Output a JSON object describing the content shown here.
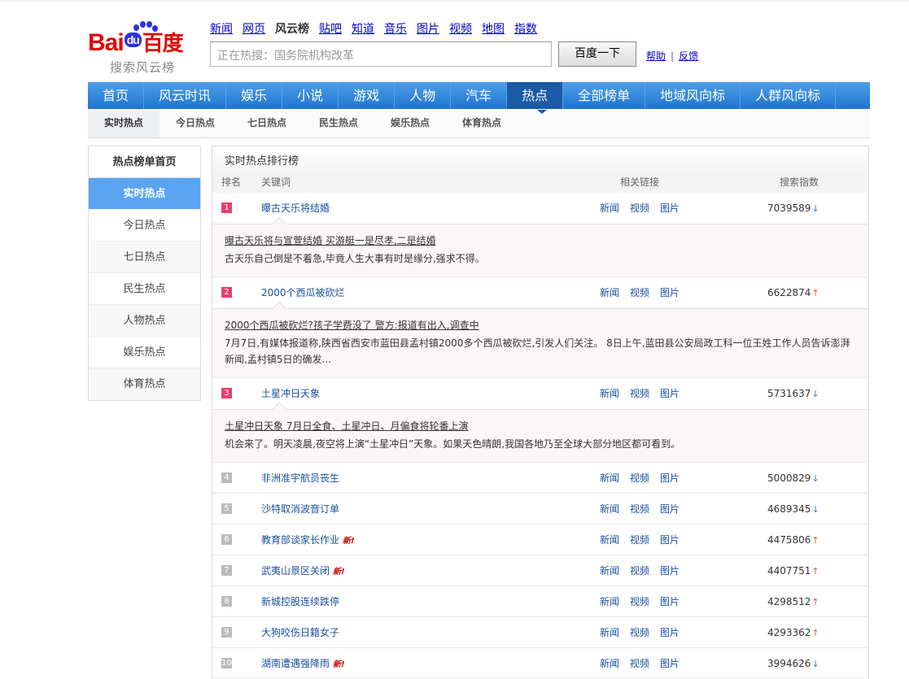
{
  "logo": {
    "text_bai": "Bai",
    "text_du": "du",
    "text_cn": "百度",
    "subtitle": "搜索风云榜"
  },
  "topnav": [
    {
      "label": "新闻",
      "current": false
    },
    {
      "label": "网页",
      "current": false
    },
    {
      "label": "风云榜",
      "current": true
    },
    {
      "label": "贴吧",
      "current": false
    },
    {
      "label": "知道",
      "current": false
    },
    {
      "label": "音乐",
      "current": false
    },
    {
      "label": "图片",
      "current": false
    },
    {
      "label": "视频",
      "current": false
    },
    {
      "label": "地图",
      "current": false
    },
    {
      "label": "指数",
      "current": false
    }
  ],
  "search": {
    "placeholder": "正在热搜：国务院机构改革",
    "button": "百度一下"
  },
  "help": {
    "help": "帮助",
    "sep": "|",
    "feedback": "反馈"
  },
  "mainnav": [
    "首页",
    "风云时讯",
    "娱乐",
    "小说",
    "游戏",
    "人物",
    "汽车",
    "热点",
    "全部榜单",
    "地域风向标",
    "人群风向标"
  ],
  "mainnav_active": "热点",
  "subnav": [
    "实时热点",
    "今日热点",
    "七日热点",
    "民生热点",
    "娱乐热点",
    "体育热点"
  ],
  "subnav_active": "实时热点",
  "sidebar": {
    "title": "热点榜单首页",
    "items": [
      "实时热点",
      "今日热点",
      "七日热点",
      "民生热点",
      "人物热点",
      "娱乐热点",
      "体育热点"
    ],
    "active": "实时热点"
  },
  "panel": {
    "title": "实时热点排行榜",
    "columns": {
      "rank": "排名",
      "keyword": "关键词",
      "links": "相关链接",
      "index": "搜索指数"
    },
    "link_labels": [
      "新闻",
      "视频",
      "图片"
    ],
    "rows": [
      {
        "rank": "1",
        "keyword": "曝古天乐将结婚",
        "index": "7039589",
        "trend": "down",
        "new": false,
        "detail": {
          "headline": "曝古天乐将与宣萱结婚 买游艇一是尽孝,二是结婚",
          "text": "古天乐自己倒是不着急,毕竟人生大事有时是缘分,强求不得。"
        }
      },
      {
        "rank": "2",
        "keyword": "2000个西瓜被砍烂",
        "index": "6622874",
        "trend": "up",
        "new": false,
        "detail": {
          "headline": "2000个西瓜被砍烂?孩子学费没了 警方:报道有出入,调查中",
          "text": "7月7日,有媒体报道称,陕西省西安市蓝田县孟村镇2000多个西瓜被砍烂,引发人们关注。 8日上午,蓝田县公安局政工科一位王姓工作人员告诉澎湃新闻,孟村镇5日的确发..."
        }
      },
      {
        "rank": "3",
        "keyword": "土星冲日天象",
        "index": "5731637",
        "trend": "down",
        "new": false,
        "detail": {
          "headline": "土星冲日天象 7月日全食、土星冲日、月偏食将轮番上演",
          "text": "机会来了。明天凌晨,夜空将上演“土星冲日”天象。如果天色晴朗,我国各地乃至全球大部分地区都可看到。"
        }
      },
      {
        "rank": "4",
        "keyword": "非洲准宇航员丧生",
        "index": "5000829",
        "trend": "down",
        "new": false
      },
      {
        "rank": "5",
        "keyword": "沙特取消波音订单",
        "index": "4689345",
        "trend": "down",
        "new": false
      },
      {
        "rank": "6",
        "keyword": "教育部谈家长作业",
        "index": "4475806",
        "trend": "up",
        "new": true
      },
      {
        "rank": "7",
        "keyword": "武夷山景区关闭",
        "index": "4407751",
        "trend": "up",
        "new": true
      },
      {
        "rank": "8",
        "keyword": "新城控股连续跌停",
        "index": "4298512",
        "trend": "up",
        "new": false
      },
      {
        "rank": "9",
        "keyword": "大狗咬伤日籍女子",
        "index": "4293362",
        "trend": "up",
        "new": false
      },
      {
        "rank": "10",
        "keyword": "湖南遭遇强降雨",
        "index": "3994626",
        "trend": "down",
        "new": true
      }
    ],
    "new_tag": "新!"
  },
  "colors": {
    "nav_blue": "#1f74d0",
    "active_nav": "#1a5aa6",
    "sidebar_active": "#5aa4f2",
    "rank_hot": "#e83e6b",
    "trend_up": "#e85b2a",
    "trend_down": "#3a7bd5"
  }
}
